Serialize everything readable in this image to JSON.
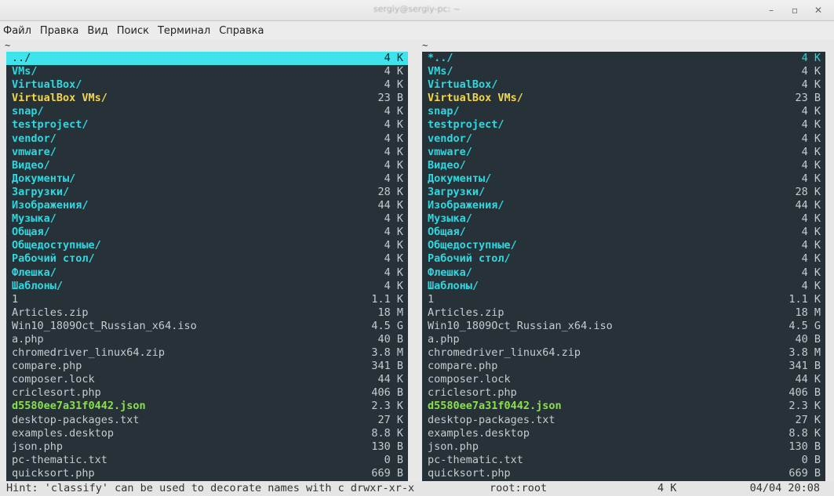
{
  "window": {
    "title": "sergiy@sergiy-pc: ~",
    "minimize_icon": "minimize-icon",
    "maximize_icon": "maximize-icon",
    "close_icon": "close-icon"
  },
  "menu": [
    "Файл",
    "Правка",
    "Вид",
    "Поиск",
    "Терминал",
    "Справка"
  ],
  "left_panel": {
    "path": "~",
    "rows": [
      {
        "name": "../",
        "size": "4 K",
        "kind": "dir",
        "selected": true
      },
      {
        "name": "VMs/",
        "size": "4 K",
        "kind": "dir"
      },
      {
        "name": "VirtualBox/",
        "size": "4 K",
        "kind": "dir"
      },
      {
        "name": "VirtualBox VMs/",
        "size": "23 B",
        "kind": "link"
      },
      {
        "name": "snap/",
        "size": "4 K",
        "kind": "dir"
      },
      {
        "name": "testproject/",
        "size": "4 K",
        "kind": "dir"
      },
      {
        "name": "vendor/",
        "size": "4 K",
        "kind": "dir"
      },
      {
        "name": "vmware/",
        "size": "4 K",
        "kind": "dir"
      },
      {
        "name": "Видео/",
        "size": "4 K",
        "kind": "dir"
      },
      {
        "name": "Документы/",
        "size": "4 K",
        "kind": "dir"
      },
      {
        "name": "Загрузки/",
        "size": "28 K",
        "kind": "dir"
      },
      {
        "name": "Изображения/",
        "size": "44 K",
        "kind": "dir"
      },
      {
        "name": "Музыка/",
        "size": "4 K",
        "kind": "dir"
      },
      {
        "name": "Общая/",
        "size": "4 K",
        "kind": "dir"
      },
      {
        "name": "Общедоступные/",
        "size": "4 K",
        "kind": "dir"
      },
      {
        "name": "Рабочий стол/",
        "size": "4 K",
        "kind": "dir"
      },
      {
        "name": "Флешка/",
        "size": "4 K",
        "kind": "dir"
      },
      {
        "name": "Шаблоны/",
        "size": "4 K",
        "kind": "dir"
      },
      {
        "name": "1",
        "size": "1.1 K",
        "kind": "file"
      },
      {
        "name": "Articles.zip",
        "size": "18 M",
        "kind": "file"
      },
      {
        "name": "Win10_1809Oct_Russian_x64.iso",
        "size": "4.5 G",
        "kind": "file"
      },
      {
        "name": "a.php",
        "size": "40 B",
        "kind": "file"
      },
      {
        "name": "chromedriver_linux64.zip",
        "size": "3.8 M",
        "kind": "file"
      },
      {
        "name": "compare.php",
        "size": "341 B",
        "kind": "file"
      },
      {
        "name": "composer.lock",
        "size": "44 K",
        "kind": "file"
      },
      {
        "name": "criclesort.php",
        "size": "406 B",
        "kind": "file"
      },
      {
        "name": "d5580ee7a31f0442.json",
        "size": "2.3 K",
        "kind": "exe"
      },
      {
        "name": "desktop-packages.txt",
        "size": "27 K",
        "kind": "file"
      },
      {
        "name": "examples.desktop",
        "size": "8.8 K",
        "kind": "file"
      },
      {
        "name": "json.php",
        "size": "130 B",
        "kind": "file"
      },
      {
        "name": "pc-thematic.txt",
        "size": "0 B",
        "kind": "file"
      },
      {
        "name": "quicksort.php",
        "size": "669 B",
        "kind": "file"
      }
    ]
  },
  "right_panel": {
    "path": "~",
    "rows": [
      {
        "name": "*../",
        "size": "4 K",
        "kind": "dir"
      },
      {
        "name": "VMs/",
        "size": "4 K",
        "kind": "dir"
      },
      {
        "name": "VirtualBox/",
        "size": "4 K",
        "kind": "dir"
      },
      {
        "name": "VirtualBox VMs/",
        "size": "23 B",
        "kind": "link"
      },
      {
        "name": "snap/",
        "size": "4 K",
        "kind": "dir"
      },
      {
        "name": "testproject/",
        "size": "4 K",
        "kind": "dir"
      },
      {
        "name": "vendor/",
        "size": "4 K",
        "kind": "dir"
      },
      {
        "name": "vmware/",
        "size": "4 K",
        "kind": "dir"
      },
      {
        "name": "Видео/",
        "size": "4 K",
        "kind": "dir"
      },
      {
        "name": "Документы/",
        "size": "4 K",
        "kind": "dir"
      },
      {
        "name": "Загрузки/",
        "size": "28 K",
        "kind": "dir"
      },
      {
        "name": "Изображения/",
        "size": "44 K",
        "kind": "dir"
      },
      {
        "name": "Музыка/",
        "size": "4 K",
        "kind": "dir"
      },
      {
        "name": "Общая/",
        "size": "4 K",
        "kind": "dir"
      },
      {
        "name": "Общедоступные/",
        "size": "4 K",
        "kind": "dir"
      },
      {
        "name": "Рабочий стол/",
        "size": "4 K",
        "kind": "dir"
      },
      {
        "name": "Флешка/",
        "size": "4 K",
        "kind": "dir"
      },
      {
        "name": "Шаблоны/",
        "size": "4 K",
        "kind": "dir"
      },
      {
        "name": "1",
        "size": "1.1 K",
        "kind": "file"
      },
      {
        "name": "Articles.zip",
        "size": "18 M",
        "kind": "file"
      },
      {
        "name": "Win10_1809Oct_Russian_x64.iso",
        "size": "4.5 G",
        "kind": "file"
      },
      {
        "name": "a.php",
        "size": "40 B",
        "kind": "file"
      },
      {
        "name": "chromedriver_linux64.zip",
        "size": "3.8 M",
        "kind": "file"
      },
      {
        "name": "compare.php",
        "size": "341 B",
        "kind": "file"
      },
      {
        "name": "composer.lock",
        "size": "44 K",
        "kind": "file"
      },
      {
        "name": "criclesort.php",
        "size": "406 B",
        "kind": "file"
      },
      {
        "name": "d5580ee7a31f0442.json",
        "size": "2.3 K",
        "kind": "exe"
      },
      {
        "name": "desktop-packages.txt",
        "size": "27 K",
        "kind": "file"
      },
      {
        "name": "examples.desktop",
        "size": "8.8 K",
        "kind": "file"
      },
      {
        "name": "json.php",
        "size": "130 B",
        "kind": "file"
      },
      {
        "name": "pc-thematic.txt",
        "size": "0 B",
        "kind": "file"
      },
      {
        "name": "quicksort.php",
        "size": "669 B",
        "kind": "file"
      }
    ]
  },
  "status": {
    "hint": "Hint: 'classify' can be used to decorate names with c drwxr-xr-x",
    "owner": "root:root",
    "size": "4 K",
    "datetime": "04/04 20:08"
  }
}
